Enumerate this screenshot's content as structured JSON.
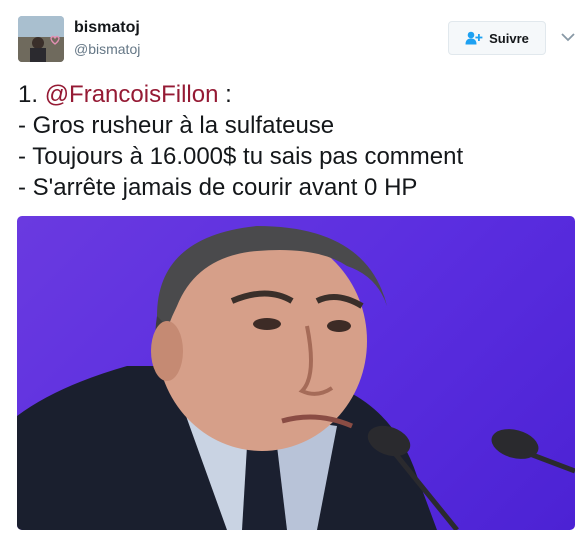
{
  "user": {
    "display_name": "bismatoj",
    "handle": "@bismatoj"
  },
  "follow_button": {
    "label": "Suivre",
    "icon": "add-user-icon"
  },
  "menu": {
    "icon": "chevron-down-icon"
  },
  "tweet": {
    "prefix": "1. ",
    "mention": "@FrancoisFillon",
    "suffix": " :",
    "lines": [
      "- Gros rusheur à la sulfateuse",
      "- Toujours à 16.000$ tu sais pas comment",
      "- S'arrête jamais de courir avant 0 HP"
    ]
  },
  "colors": {
    "mention": "#951a34",
    "media_background": "#5b2ee0",
    "text": "#14171a",
    "secondary_text": "#657786"
  }
}
